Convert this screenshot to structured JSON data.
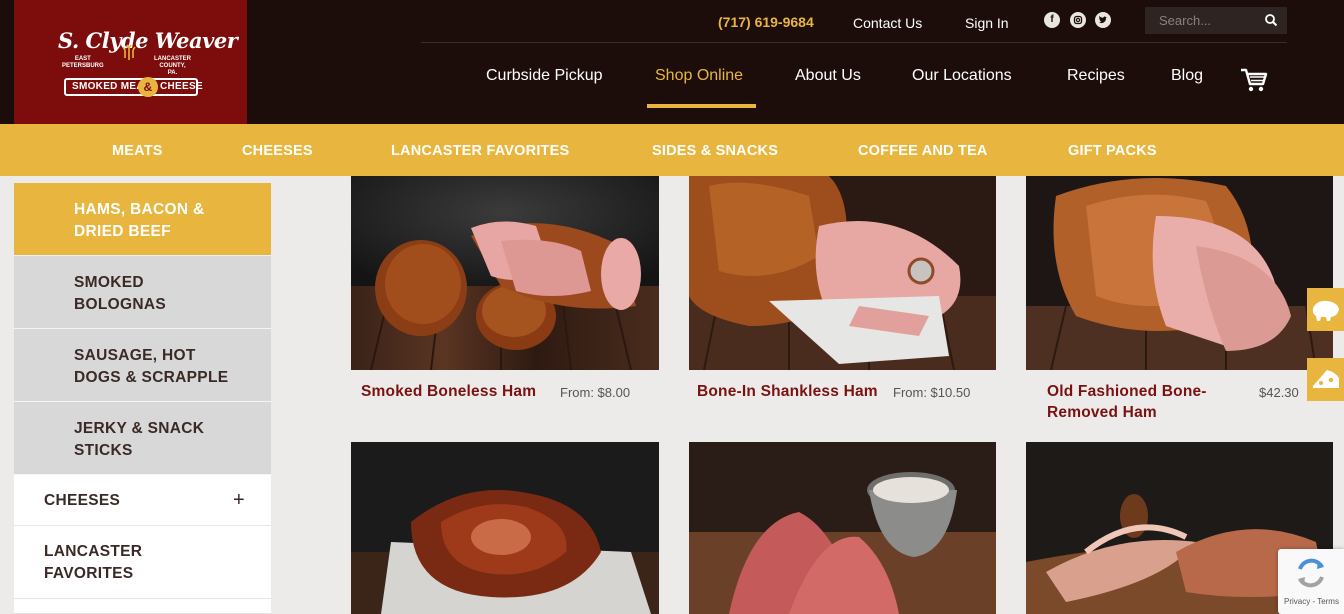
{
  "brand": {
    "name": "S. Clyde Weaver",
    "small_left": [
      "EAST",
      "PETERSBURG"
    ],
    "small_right": [
      "LANCASTER",
      "COUNTY,",
      "PA."
    ],
    "banner_left": "SMOKED MEATS",
    "banner_amp": "&",
    "banner_right": "CHEESE",
    "color_primary": "#7d0c0c",
    "color_accent": "#e8b53e"
  },
  "topbar": {
    "phone": "(717) 619-9684",
    "contact": "Contact Us",
    "signin": "Sign In",
    "social_icons": [
      "facebook-icon",
      "instagram-icon",
      "twitter-icon"
    ],
    "search_placeholder": "Search..."
  },
  "mainnav": {
    "items": [
      "Curbside Pickup",
      "Shop Online",
      "About Us",
      "Our Locations",
      "Recipes",
      "Blog"
    ],
    "active": "Shop Online"
  },
  "categories": [
    "MEATS",
    "CHEESES",
    "LANCASTER FAVORITES",
    "SIDES & SNACKS",
    "COFFEE AND TEA",
    "GIFT PACKS"
  ],
  "sidebar": {
    "sub_items": [
      {
        "line1": "HAMS, BACON &",
        "line2": "DRIED BEEF",
        "active": true
      },
      {
        "line1": "SMOKED",
        "line2": "BOLOGNAS",
        "active": false
      },
      {
        "line1": "SAUSAGE, HOT",
        "line2": "DOGS & SCRAPPLE",
        "active": false
      },
      {
        "line1": "JERKY & SNACK",
        "line2": "STICKS",
        "active": false
      }
    ],
    "top_items": [
      {
        "line1": "CHEESES",
        "line2": "",
        "expander": "+"
      },
      {
        "line1": "LANCASTER",
        "line2": "FAVORITES",
        "expander": ""
      }
    ]
  },
  "products": [
    {
      "name_line1": "Smoked Boneless Ham",
      "name_line2": "",
      "price": "From: $8.00"
    },
    {
      "name_line1": "Bone-In Shankless Ham",
      "name_line2": "",
      "price": "From: $10.50"
    },
    {
      "name_line1": "Old Fashioned Bone-",
      "name_line2": "Removed Ham",
      "price": "$42.30"
    }
  ],
  "recaptcha": {
    "text": "Privacy - Terms"
  }
}
